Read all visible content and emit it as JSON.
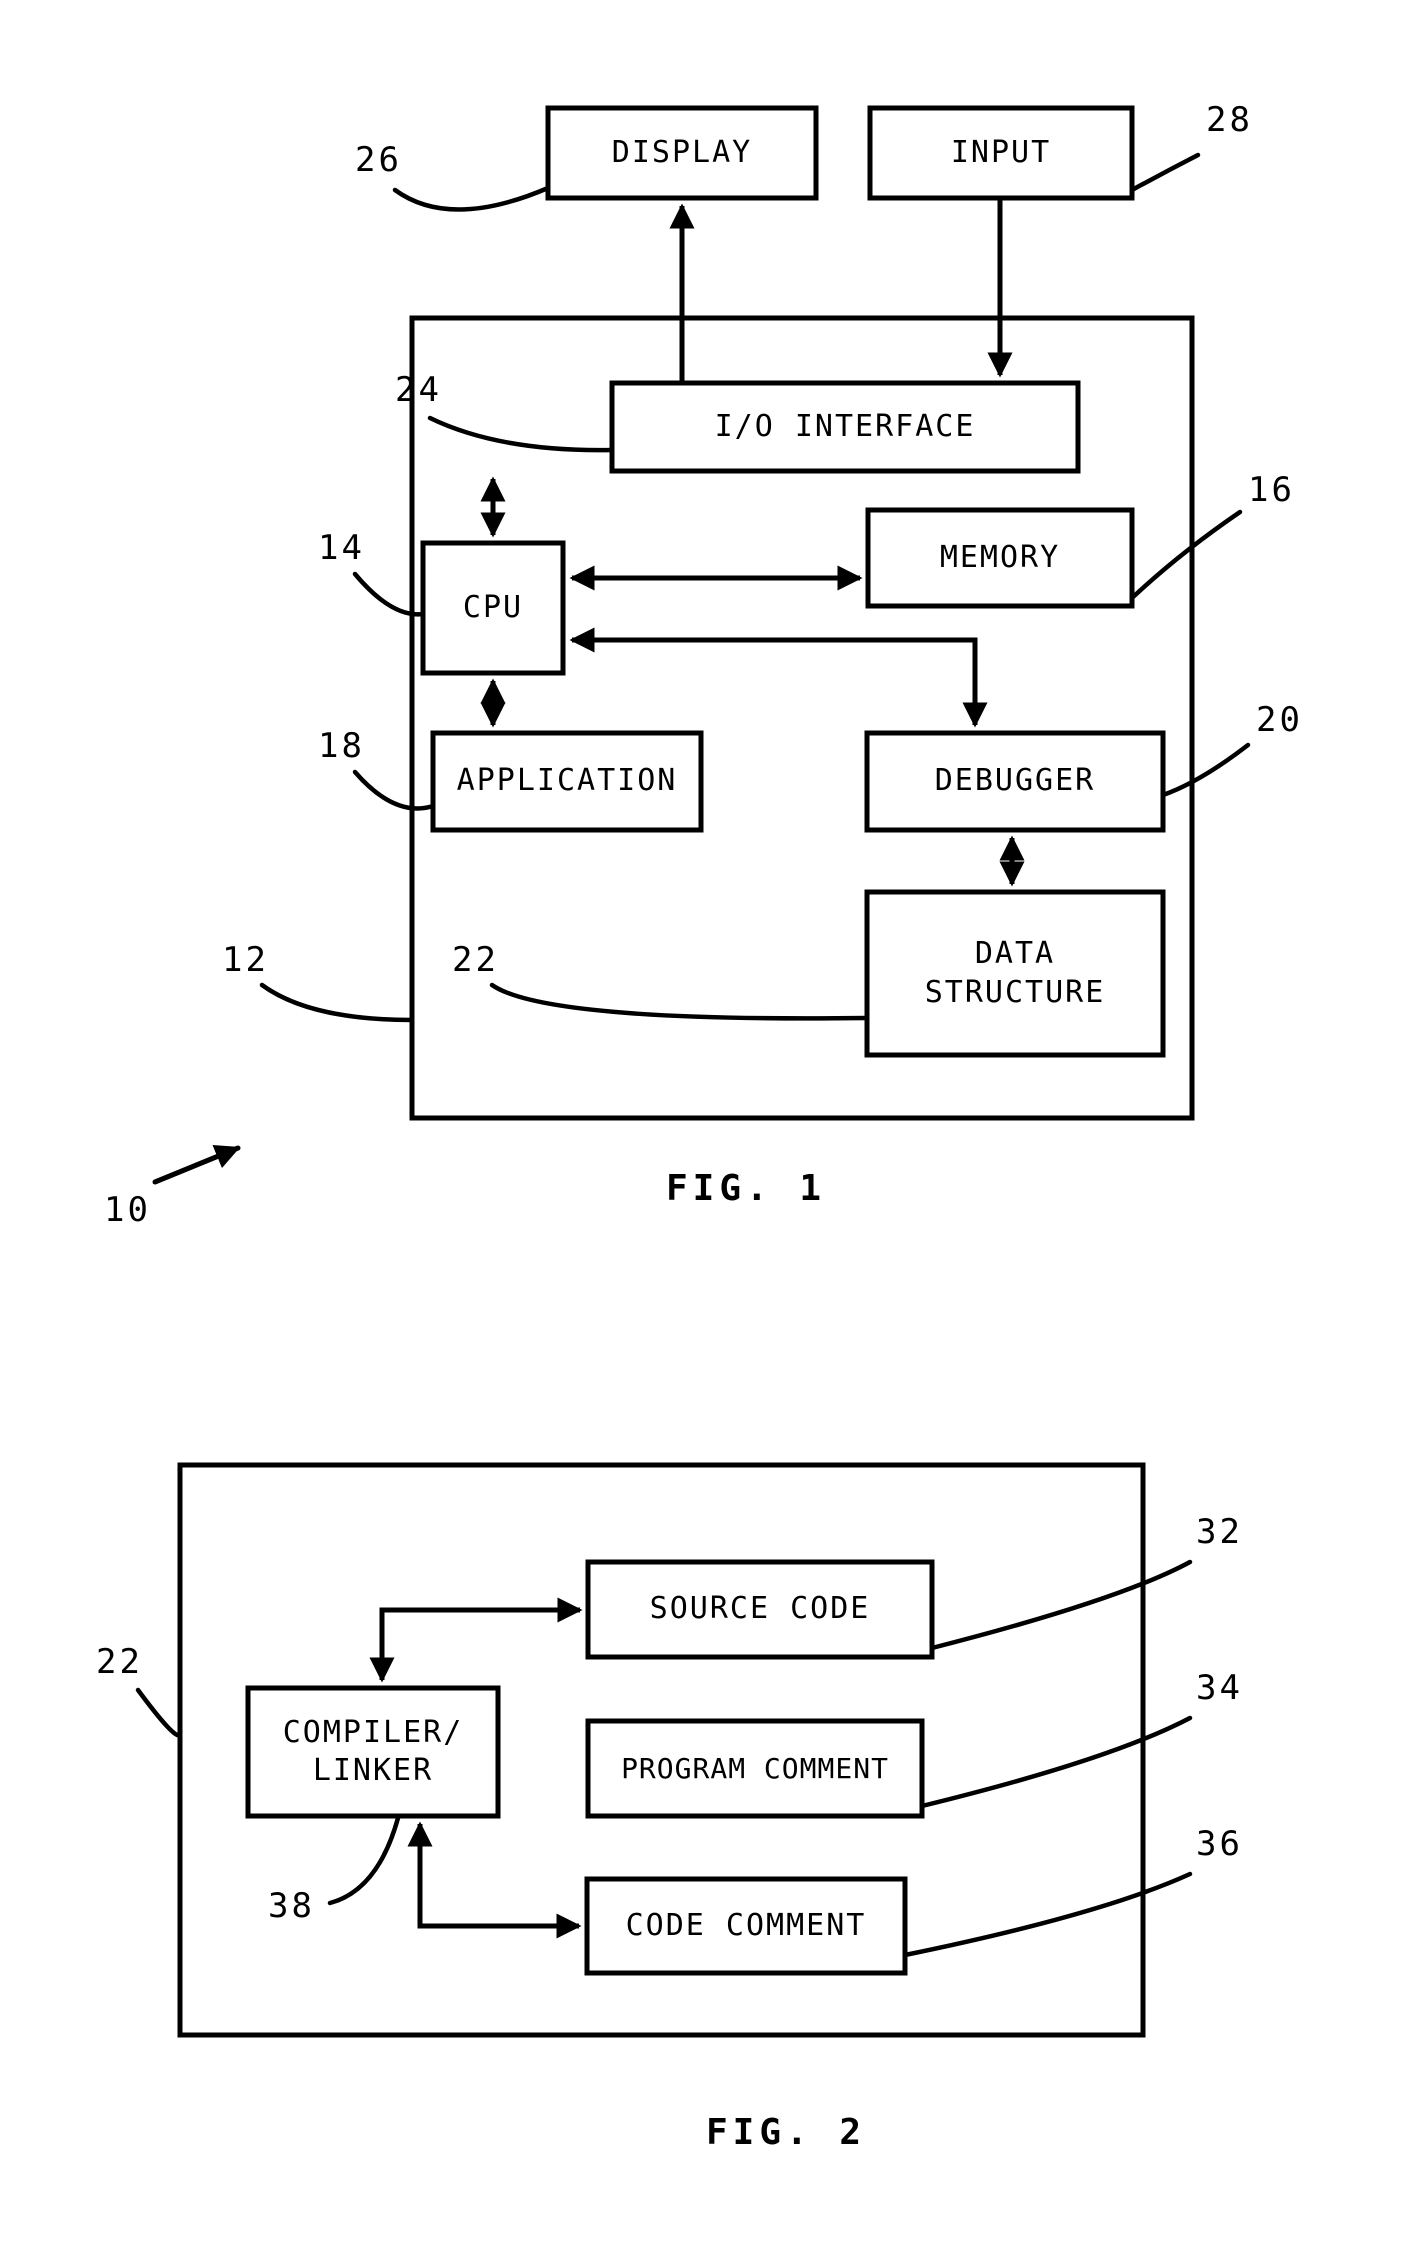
{
  "document": {
    "kind": "patent-figure-sheet",
    "figures": [
      {
        "id": "fig1",
        "caption": "FIG. 1",
        "system_reference": "10",
        "outer_container_reference": "12",
        "boxes": [
          {
            "key": "display",
            "label": "DISPLAY",
            "reference": "26"
          },
          {
            "key": "input",
            "label": "INPUT",
            "reference": "28"
          },
          {
            "key": "io_interface",
            "label": "I/O INTERFACE",
            "reference": "24"
          },
          {
            "key": "cpu",
            "label": "CPU",
            "reference": "14"
          },
          {
            "key": "memory",
            "label": "MEMORY",
            "reference": "16"
          },
          {
            "key": "application",
            "label": "APPLICATION",
            "reference": "18"
          },
          {
            "key": "debugger",
            "label": "DEBUGGER",
            "reference": "20"
          },
          {
            "key": "data_structure",
            "label": "DATA\nSTRUCTURE",
            "reference": "22"
          }
        ]
      },
      {
        "id": "fig2",
        "caption": "FIG. 2",
        "outer_container_reference": "22",
        "boxes": [
          {
            "key": "compiler_linker",
            "label": "COMPILER/\nLINKER",
            "reference": "38"
          },
          {
            "key": "source_code",
            "label": "SOURCE CODE",
            "reference": "32"
          },
          {
            "key": "program_comment",
            "label": "PROGRAM COMMENT",
            "reference": "34"
          },
          {
            "key": "code_comment",
            "label": "CODE COMMENT",
            "reference": "36"
          }
        ]
      }
    ]
  },
  "fig1": {
    "caption": "FIG. 1",
    "boxes": {
      "display": "DISPLAY",
      "input": "INPUT",
      "io_interface": "I/O INTERFACE",
      "cpu": "CPU",
      "memory": "MEMORY",
      "application": "APPLICATION",
      "debugger": "DEBUGGER",
      "data_structure": "DATA\nSTRUCTURE"
    },
    "refs": {
      "system": "10",
      "computer": "12",
      "cpu": "14",
      "memory": "16",
      "application": "18",
      "debugger": "20",
      "data_structure": "22",
      "io_interface": "24",
      "display": "26",
      "input": "28"
    }
  },
  "fig2": {
    "caption": "FIG. 2",
    "boxes": {
      "compiler_linker": "COMPILER/\nLINKER",
      "source_code": "SOURCE CODE",
      "program_comment": "PROGRAM COMMENT",
      "code_comment": "CODE COMMENT"
    },
    "refs": {
      "data_structure": "22",
      "source_code": "32",
      "program_comment": "34",
      "code_comment": "36",
      "compiler_linker": "38"
    }
  },
  "colors": {
    "ink": "#000000",
    "paper": "#ffffff"
  }
}
